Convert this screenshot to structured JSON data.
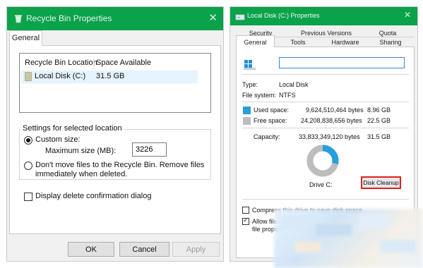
{
  "left": {
    "title": "Recycle Bin Properties",
    "tab_general": "General",
    "list_headers": [
      "Recycle Bin Location",
      "Space Available"
    ],
    "list_row": {
      "location": "Local Disk (C:)",
      "space": "31.5 GB"
    },
    "settings_group": "Settings for selected location",
    "custom_size": "Custom size:",
    "max_size_label": "Maximum size (MB):",
    "max_size_value": "3226",
    "dont_move_line1": "Don't move files to the Recycle Bin. Remove files",
    "dont_move_line2": "immediately when deleted.",
    "display_confirm": "Display delete confirmation dialog",
    "buttons": {
      "ok": "OK",
      "cancel": "Cancel",
      "apply": "Apply"
    },
    "custom_size_selected": true
  },
  "right": {
    "title": "Local Disk (C:) Properties",
    "tabs_row1": [
      "Security",
      "Previous Versions",
      "Quota"
    ],
    "tabs_row2": [
      "General",
      "Tools",
      "Hardware",
      "Sharing"
    ],
    "selected_tab": "General",
    "name_value": "",
    "type_label": "Type:",
    "type_value": "Local Disk",
    "fs_label": "File system:",
    "fs_value": "NTFS",
    "used_label": "Used space:",
    "used_bytes": "9,624,510,464 bytes",
    "used_gb": "8.96 GB",
    "free_label": "Free space:",
    "free_bytes": "24,208,838,656 bytes",
    "free_gb": "22.5 GB",
    "capacity_label": "Capacity:",
    "capacity_bytes": "33,833,349,120 bytes",
    "capacity_gb": "31.5 GB",
    "drive_label": "Drive C:",
    "disk_cleanup": "Disk Cleanup",
    "compress_text": "Compress this drive to save disk space",
    "allow_files_line1": "Allow files",
    "allow_files_line2": "file propert",
    "used_fraction": 0.284,
    "colors": {
      "used": "#26a0da",
      "free": "#bdbdbd",
      "titlebar": "#0aa24a",
      "highlight": "#e02020"
    }
  }
}
